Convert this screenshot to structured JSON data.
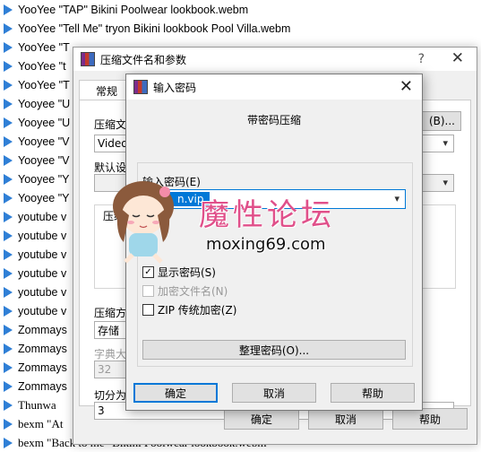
{
  "file_list": [
    {
      "name": "YooYee \"TAP\" Bikini Poolwear lookbook.webm",
      "serif": false
    },
    {
      "name": "YooYee \"Tell Me\" tryon Bikini lookbook Pool Villa.webm",
      "serif": false
    },
    {
      "name": "YooYee \"T",
      "serif": false
    },
    {
      "name": "YooYee \"t",
      "serif": false
    },
    {
      "name": "YooYee \"T",
      "serif": false
    },
    {
      "name": "Yooyee \"U",
      "serif": false
    },
    {
      "name": "Yooyee \"U",
      "serif": false
    },
    {
      "name": "Yooyee \"V",
      "serif": false
    },
    {
      "name": "Yooyee \"V",
      "serif": false
    },
    {
      "name": "Yooyee \"Y",
      "serif": false
    },
    {
      "name": "Yooyee \"Y",
      "serif": false
    },
    {
      "name": "youtube v",
      "serif": false
    },
    {
      "name": "youtube v",
      "serif": false
    },
    {
      "name": "youtube v",
      "serif": false
    },
    {
      "name": "youtube v",
      "serif": false
    },
    {
      "name": "youtube v",
      "serif": false
    },
    {
      "name": "youtube v",
      "serif": false
    },
    {
      "name": "Zommays",
      "serif": false
    },
    {
      "name": "Zommays",
      "serif": false
    },
    {
      "name": "Zommays",
      "serif": false
    },
    {
      "name": "Zommays",
      "serif": false
    },
    {
      "name": "Thunwa",
      "serif": true
    },
    {
      "name": "bexm \"At",
      "serif": true
    },
    {
      "name": "bexm \"Back to me\" Bikini Poolwear lookbook.webm",
      "serif": true
    }
  ],
  "outer_dialog": {
    "title": "压缩文件名和参数",
    "help": "?",
    "close": "✕",
    "tab_general": "常规",
    "archive_name_label": "压缩文",
    "archive_name_value": "Videos",
    "browse_button": "(B)...",
    "default_profile_label": "默认设",
    "format_label": "压缩",
    "method_label": "压缩方",
    "method_value": "存储",
    "dict_label": "字典大",
    "dict_value": "32",
    "split_label": "切分为",
    "split_value": "3",
    "ok_button": "确定",
    "cancel_button": "取消",
    "help_button": "帮助"
  },
  "password_dialog": {
    "title": "输入密码",
    "close": "✕",
    "subtitle": "带密码压缩",
    "password_label": "输入密码(E)",
    "password_value": "n.vip",
    "show_password": {
      "label": "显示密码(S)",
      "checked": true
    },
    "encrypt_names": {
      "label": "加密文件名(N)",
      "checked": false,
      "disabled": true
    },
    "zip_legacy": {
      "label": "ZIP 传统加密(Z)",
      "checked": false
    },
    "manage_button": "整理密码(O)...",
    "ok_button": "确定",
    "cancel_button": "取消",
    "help_button": "帮助"
  },
  "watermark": {
    "chinese": "魔性论坛",
    "url": "moxing69.com"
  },
  "colors": {
    "accent": "#0078d7",
    "play_icon": "#2f7fd6",
    "watermark_pink": "#e0508a"
  }
}
